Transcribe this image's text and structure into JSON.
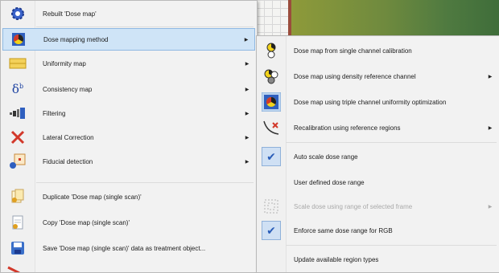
{
  "main_menu": {
    "items": [
      {
        "label": "Rebuilt 'Dose map'",
        "icon": "gear-icon",
        "submenu": false
      },
      {
        "label": "Dose mapping method",
        "icon": "dose-map-icon",
        "submenu": true,
        "highlighted": true
      },
      {
        "label": "Uniformity map",
        "icon": "uniformity-map-icon",
        "submenu": true
      },
      {
        "label": "Consistency map",
        "icon": "delta-icon",
        "submenu": true
      },
      {
        "label": "Filtering",
        "icon": "filter-icon",
        "submenu": true
      },
      {
        "label": "Lateral Correction",
        "icon": "lateral-correction-icon",
        "submenu": true
      },
      {
        "label": "Fiducial detection",
        "icon": "fiducial-icon",
        "submenu": true
      },
      {
        "label": "Duplicate 'Dose map (single scan)'",
        "icon": "duplicate-icon",
        "submenu": false
      },
      {
        "label": "Copy 'Dose map (single scan)'",
        "icon": "copy-icon",
        "submenu": false
      },
      {
        "label": "Save 'Dose map (single scan)' data as treatment object...",
        "icon": "save-icon",
        "submenu": false
      }
    ]
  },
  "sub_menu": {
    "items": [
      {
        "label": "Dose map from single channel calibration",
        "icon": "single-channel-icon",
        "submenu": false
      },
      {
        "label": "Dose map using density reference channel",
        "icon": "density-reference-icon",
        "submenu": true
      },
      {
        "label": "Dose map using triple channel uniformity optimization",
        "icon": "triple-channel-icon",
        "submenu": false
      },
      {
        "label": "Recalibration using reference regions",
        "icon": "recalibration-icon",
        "submenu": true
      },
      {
        "label": "Auto scale dose range",
        "icon": "check-icon",
        "submenu": false
      },
      {
        "label": "User defined dose range",
        "icon": "",
        "submenu": false
      },
      {
        "label": "Scale dose using range of selected frame",
        "icon": "scale-frame-icon",
        "submenu": true,
        "disabled": true
      },
      {
        "label": "Enforce same dose range for RGB",
        "icon": "check-icon",
        "submenu": false
      },
      {
        "label": "Update available region types",
        "icon": "",
        "submenu": false
      }
    ]
  },
  "colors": {
    "highlight": "#cfe4f7",
    "highlight_border": "#8fb9e3",
    "menu_bg": "#f2f2f2"
  }
}
